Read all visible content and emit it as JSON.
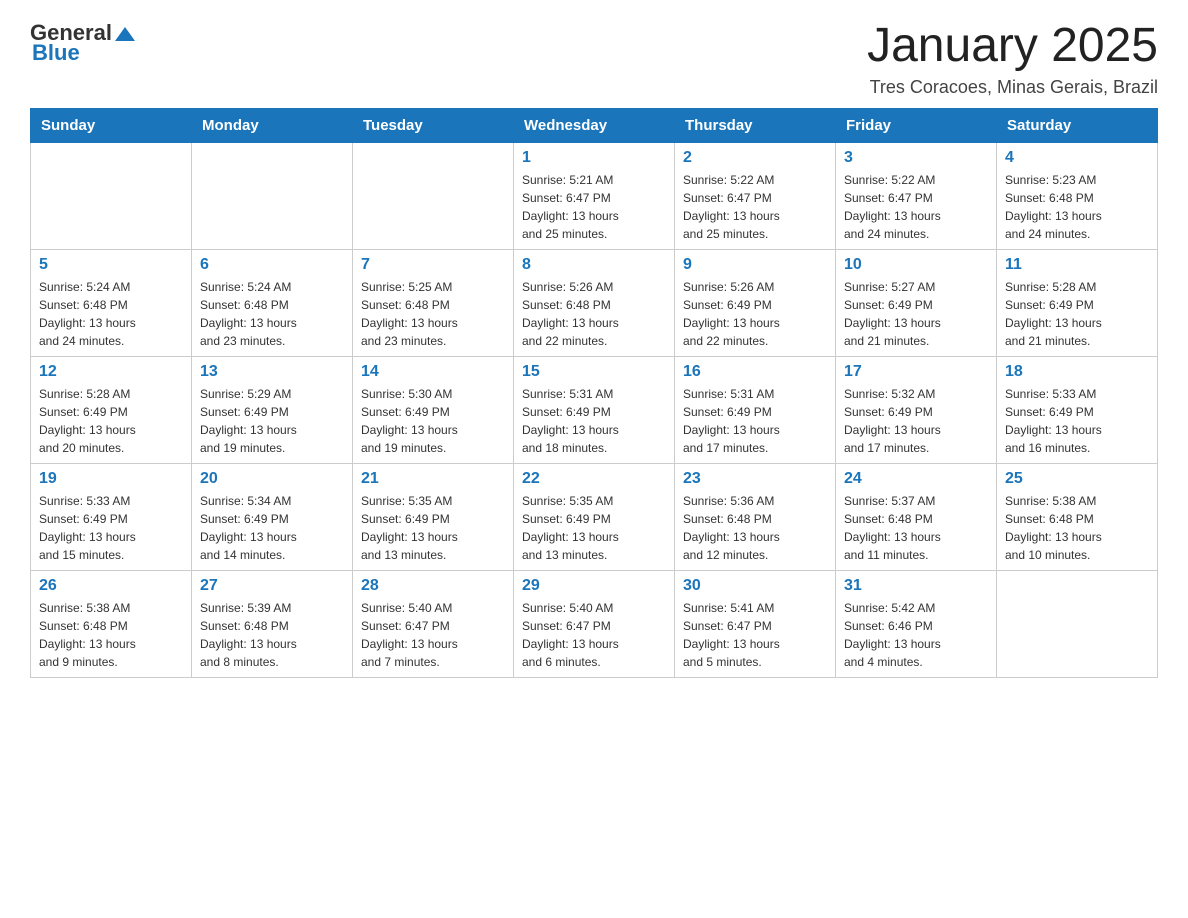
{
  "header": {
    "logo": {
      "general": "General",
      "blue": "Blue"
    },
    "title": "January 2025",
    "subtitle": "Tres Coracoes, Minas Gerais, Brazil"
  },
  "days_of_week": [
    "Sunday",
    "Monday",
    "Tuesday",
    "Wednesday",
    "Thursday",
    "Friday",
    "Saturday"
  ],
  "weeks": [
    [
      {
        "day": "",
        "info": ""
      },
      {
        "day": "",
        "info": ""
      },
      {
        "day": "",
        "info": ""
      },
      {
        "day": "1",
        "info": "Sunrise: 5:21 AM\nSunset: 6:47 PM\nDaylight: 13 hours\nand 25 minutes."
      },
      {
        "day": "2",
        "info": "Sunrise: 5:22 AM\nSunset: 6:47 PM\nDaylight: 13 hours\nand 25 minutes."
      },
      {
        "day": "3",
        "info": "Sunrise: 5:22 AM\nSunset: 6:47 PM\nDaylight: 13 hours\nand 24 minutes."
      },
      {
        "day": "4",
        "info": "Sunrise: 5:23 AM\nSunset: 6:48 PM\nDaylight: 13 hours\nand 24 minutes."
      }
    ],
    [
      {
        "day": "5",
        "info": "Sunrise: 5:24 AM\nSunset: 6:48 PM\nDaylight: 13 hours\nand 24 minutes."
      },
      {
        "day": "6",
        "info": "Sunrise: 5:24 AM\nSunset: 6:48 PM\nDaylight: 13 hours\nand 23 minutes."
      },
      {
        "day": "7",
        "info": "Sunrise: 5:25 AM\nSunset: 6:48 PM\nDaylight: 13 hours\nand 23 minutes."
      },
      {
        "day": "8",
        "info": "Sunrise: 5:26 AM\nSunset: 6:48 PM\nDaylight: 13 hours\nand 22 minutes."
      },
      {
        "day": "9",
        "info": "Sunrise: 5:26 AM\nSunset: 6:49 PM\nDaylight: 13 hours\nand 22 minutes."
      },
      {
        "day": "10",
        "info": "Sunrise: 5:27 AM\nSunset: 6:49 PM\nDaylight: 13 hours\nand 21 minutes."
      },
      {
        "day": "11",
        "info": "Sunrise: 5:28 AM\nSunset: 6:49 PM\nDaylight: 13 hours\nand 21 minutes."
      }
    ],
    [
      {
        "day": "12",
        "info": "Sunrise: 5:28 AM\nSunset: 6:49 PM\nDaylight: 13 hours\nand 20 minutes."
      },
      {
        "day": "13",
        "info": "Sunrise: 5:29 AM\nSunset: 6:49 PM\nDaylight: 13 hours\nand 19 minutes."
      },
      {
        "day": "14",
        "info": "Sunrise: 5:30 AM\nSunset: 6:49 PM\nDaylight: 13 hours\nand 19 minutes."
      },
      {
        "day": "15",
        "info": "Sunrise: 5:31 AM\nSunset: 6:49 PM\nDaylight: 13 hours\nand 18 minutes."
      },
      {
        "day": "16",
        "info": "Sunrise: 5:31 AM\nSunset: 6:49 PM\nDaylight: 13 hours\nand 17 minutes."
      },
      {
        "day": "17",
        "info": "Sunrise: 5:32 AM\nSunset: 6:49 PM\nDaylight: 13 hours\nand 17 minutes."
      },
      {
        "day": "18",
        "info": "Sunrise: 5:33 AM\nSunset: 6:49 PM\nDaylight: 13 hours\nand 16 minutes."
      }
    ],
    [
      {
        "day": "19",
        "info": "Sunrise: 5:33 AM\nSunset: 6:49 PM\nDaylight: 13 hours\nand 15 minutes."
      },
      {
        "day": "20",
        "info": "Sunrise: 5:34 AM\nSunset: 6:49 PM\nDaylight: 13 hours\nand 14 minutes."
      },
      {
        "day": "21",
        "info": "Sunrise: 5:35 AM\nSunset: 6:49 PM\nDaylight: 13 hours\nand 13 minutes."
      },
      {
        "day": "22",
        "info": "Sunrise: 5:35 AM\nSunset: 6:49 PM\nDaylight: 13 hours\nand 13 minutes."
      },
      {
        "day": "23",
        "info": "Sunrise: 5:36 AM\nSunset: 6:48 PM\nDaylight: 13 hours\nand 12 minutes."
      },
      {
        "day": "24",
        "info": "Sunrise: 5:37 AM\nSunset: 6:48 PM\nDaylight: 13 hours\nand 11 minutes."
      },
      {
        "day": "25",
        "info": "Sunrise: 5:38 AM\nSunset: 6:48 PM\nDaylight: 13 hours\nand 10 minutes."
      }
    ],
    [
      {
        "day": "26",
        "info": "Sunrise: 5:38 AM\nSunset: 6:48 PM\nDaylight: 13 hours\nand 9 minutes."
      },
      {
        "day": "27",
        "info": "Sunrise: 5:39 AM\nSunset: 6:48 PM\nDaylight: 13 hours\nand 8 minutes."
      },
      {
        "day": "28",
        "info": "Sunrise: 5:40 AM\nSunset: 6:47 PM\nDaylight: 13 hours\nand 7 minutes."
      },
      {
        "day": "29",
        "info": "Sunrise: 5:40 AM\nSunset: 6:47 PM\nDaylight: 13 hours\nand 6 minutes."
      },
      {
        "day": "30",
        "info": "Sunrise: 5:41 AM\nSunset: 6:47 PM\nDaylight: 13 hours\nand 5 minutes."
      },
      {
        "day": "31",
        "info": "Sunrise: 5:42 AM\nSunset: 6:46 PM\nDaylight: 13 hours\nand 4 minutes."
      },
      {
        "day": "",
        "info": ""
      }
    ]
  ]
}
